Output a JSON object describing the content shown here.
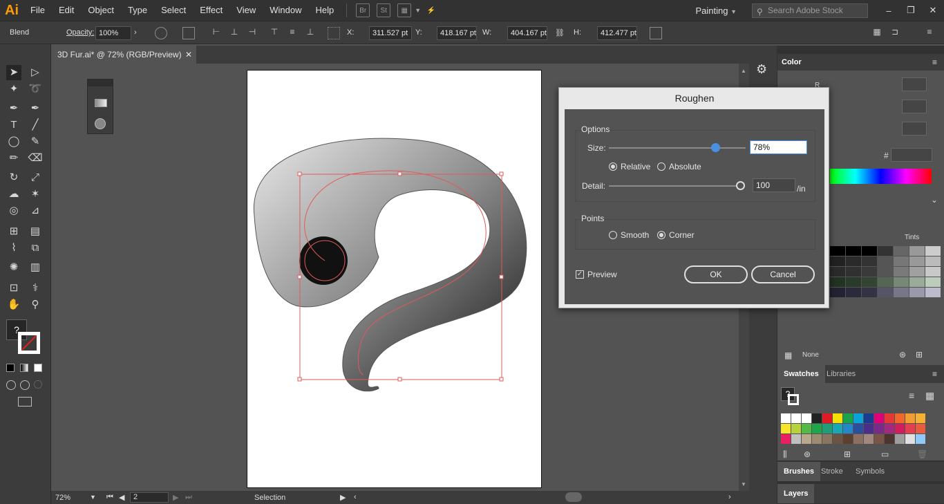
{
  "app": {
    "logo": "Ai"
  },
  "menu": [
    "File",
    "Edit",
    "Object",
    "Type",
    "Select",
    "Effect",
    "View",
    "Window",
    "Help"
  ],
  "menubar_icons": {
    "bridge": "Br",
    "stock": "St"
  },
  "workspace": "Painting",
  "search": {
    "placeholder": "Search Adobe Stock"
  },
  "window_controls": [
    "–",
    "❐",
    "✕"
  ],
  "control_bar": {
    "object_type": "Blend",
    "opacity_label": "Opacity:",
    "opacity_value": "100%",
    "x_label": "X:",
    "x_value": "311.527 pt",
    "y_label": "Y:",
    "y_value": "418.167 pt",
    "w_label": "W:",
    "w_value": "404.167 pt",
    "h_label": "H:",
    "h_value": "412.477 pt"
  },
  "document_tab": {
    "title": "3D Fur.ai* @ 72% (RGB/Preview)",
    "close": "✕"
  },
  "status_bar": {
    "zoom": "72%",
    "artboard": "2",
    "tool": "Selection"
  },
  "dialog": {
    "title": "Roughen",
    "options_label": "Options",
    "size_label": "Size:",
    "size_value": "78%",
    "size_fraction": 0.78,
    "relative_label": "Relative",
    "absolute_label": "Absolute",
    "detail_label": "Detail:",
    "detail_value": "100",
    "detail_unit": "/in",
    "detail_fraction": 1.0,
    "points_label": "Points",
    "smooth_label": "Smooth",
    "corner_label": "Corner",
    "preview_label": "Preview",
    "ok_label": "OK",
    "cancel_label": "Cancel"
  },
  "color_panel": {
    "title": "Color",
    "r_label": "R",
    "hex_label": "#"
  },
  "swatch_tints": {
    "label": "Tints",
    "none_label": "None"
  },
  "swatches_panel": {
    "tabs": [
      "Swatches",
      "Libraries"
    ],
    "unknown_fill": "?"
  },
  "bottom_tabs": [
    "Brushes",
    "Stroke",
    "Symbols"
  ],
  "layers_tab": "Layers",
  "tools_unknown_fill": "?",
  "colors": {
    "accent": "#4a90e2",
    "selection": "#e05a5a"
  }
}
